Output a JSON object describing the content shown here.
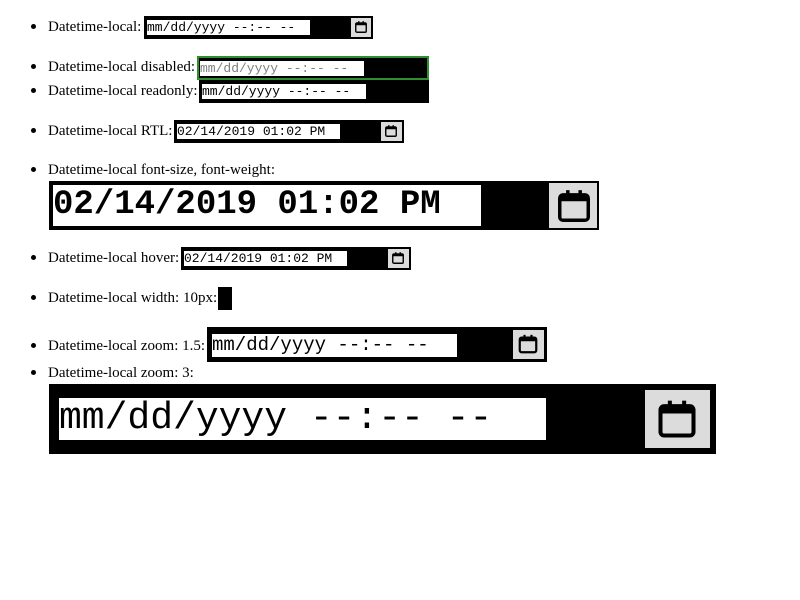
{
  "items": [
    {
      "label": "Datetime-local:",
      "value": "mm/dd/yyyy --:-- --",
      "state": "default"
    },
    {
      "label": "Datetime-local disabled:",
      "value": "mm/dd/yyyy --:-- --",
      "state": "disabled"
    },
    {
      "label": "Datetime-local readonly:",
      "value": "mm/dd/yyyy --:-- --",
      "state": "readonly"
    },
    {
      "label": "Datetime-local RTL:",
      "value": "02/14/2019 01:02 PM",
      "state": "rtl"
    },
    {
      "label": "Datetime-local font-size, font-weight:",
      "value": "02/14/2019 01:02 PM",
      "state": "large"
    },
    {
      "label": "Datetime-local hover:",
      "value": "02/14/2019 01:02 PM",
      "state": "hover"
    },
    {
      "label": "Datetime-local width: 10px:",
      "value": "",
      "state": "narrow"
    },
    {
      "label": "Datetime-local zoom: 1.5:",
      "value": "mm/dd/yyyy --:-- --",
      "state": "zoom-1.5"
    },
    {
      "label": "Datetime-local zoom: 3:",
      "value": "mm/dd/yyyy --:-- --",
      "state": "zoom-3"
    }
  ],
  "colors": {
    "field_bg": "#000000",
    "text_bg": "#ffffff",
    "picker_button_bg": "#dcdcdc",
    "disabled_border": "#2f8f2f",
    "disabled_text": "#808080"
  },
  "icons": {
    "picker": "calendar-icon"
  }
}
